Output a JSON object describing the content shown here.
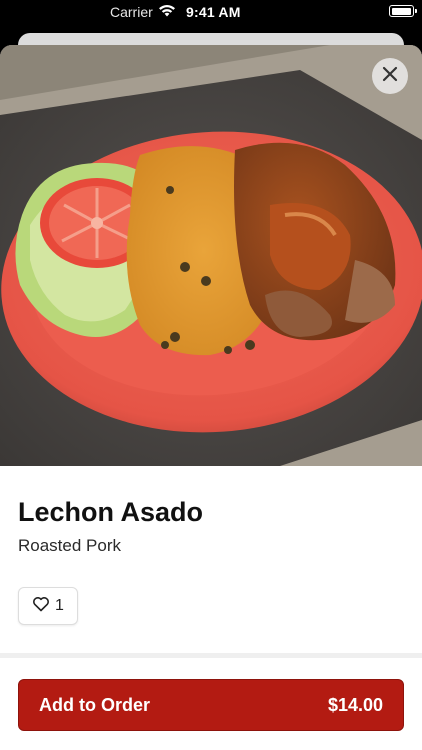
{
  "status_bar": {
    "carrier": "Carrier",
    "time": "9:41 AM",
    "battery_level": 0.9,
    "icons": [
      "wifi-icon",
      "battery-icon"
    ]
  },
  "dish": {
    "image": "roasted-pork-plate-photo",
    "title": "Lechon Asado",
    "subtitle": "Roasted Pork",
    "likes": "1"
  },
  "actions": {
    "close_icon": "close-icon",
    "like_icon": "heart-icon",
    "add_label": "Add to Order",
    "price": "$14.00"
  },
  "colors": {
    "accent": "#b31b12",
    "plate": "#e8584a",
    "background": "#ffffff"
  }
}
